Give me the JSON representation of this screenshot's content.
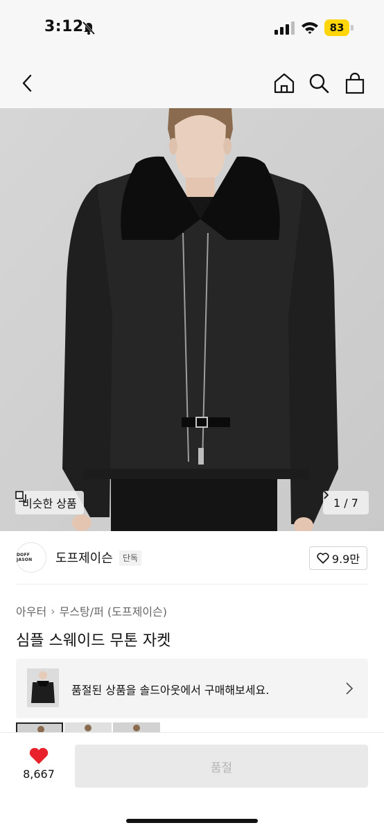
{
  "status_bar": {
    "time": "3:12",
    "battery": "83",
    "icons": [
      "bell-off-icon",
      "cellular-signal-icon",
      "wifi-icon",
      "battery-icon"
    ]
  },
  "nav": {
    "icons": [
      "back-chevron-icon",
      "home-icon",
      "search-icon",
      "shopping-bag-icon"
    ]
  },
  "hero": {
    "similar_label": "비슷한 상품",
    "page_indicator": "1 / 7"
  },
  "brand": {
    "logo_text": "DOFF JASON",
    "name": "도프제이슨",
    "tag": "단독",
    "likes": "9.9만"
  },
  "product": {
    "breadcrumb": [
      "아우터",
      "무스탕/퍼 (도프제이슨)"
    ],
    "title": "심플 스웨이드 무톤 자켓"
  },
  "soldout_banner": {
    "text": "품절된 상품을 솔드아웃에서 구매해보세요."
  },
  "bottom_bar": {
    "like_count": "8,667",
    "buy_button_label": "품절"
  },
  "colors": {
    "heart": "#e8212b",
    "battery": "#ffd60a",
    "disabled_button": "#e9e9e9",
    "disabled_text": "#b5b5b5"
  }
}
